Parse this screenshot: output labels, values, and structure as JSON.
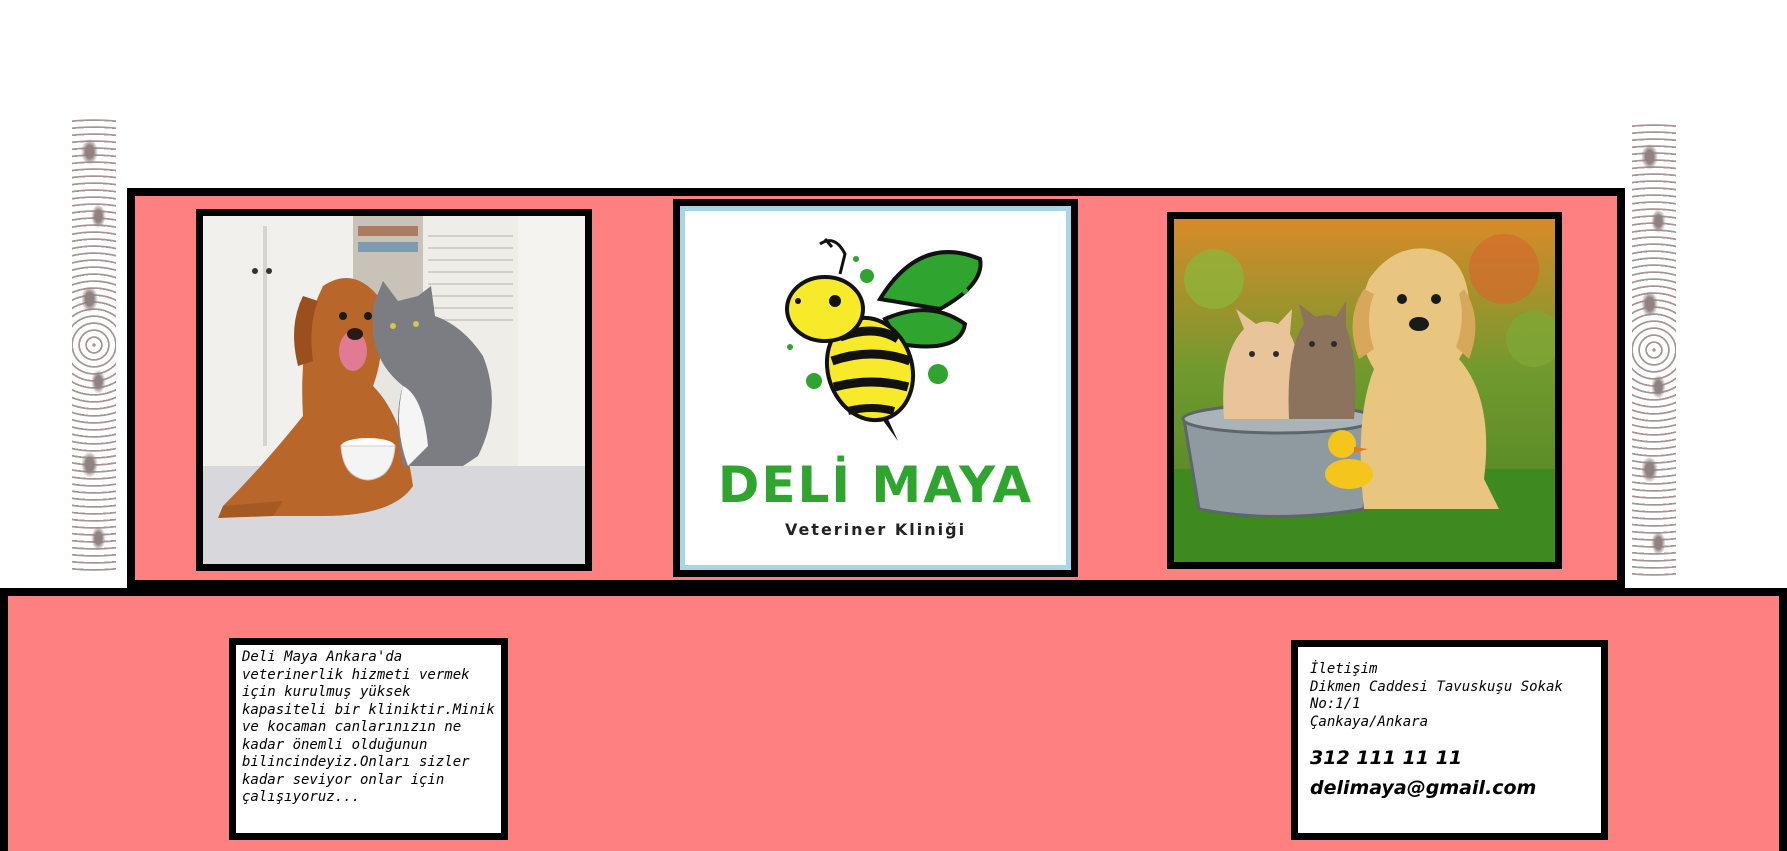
{
  "logo": {
    "title": "DELİ MAYA",
    "subtitle": "Veteriner Kliniği",
    "brand_green": "#2fa52f",
    "bee_yellow": "#f6ea2b"
  },
  "images": {
    "left": "dog-and-cat-photo",
    "right": "puppy-and-kittens-photo"
  },
  "about": {
    "text": "Deli Maya Ankara'da veterinerlik hizmeti vermek için kurulmuş yüksek kapasiteli bir kliniktir.Minik ve kocaman canlarınızın ne kadar önemli olduğunun bilincindeyiz.Onları sizler kadar seviyor onlar için çalışıyoruz..."
  },
  "contact": {
    "heading": "İletişim",
    "address_line1": "Dikmen Caddesi Tavuskuşu Sokak",
    "address_line2": "No:1/1",
    "address_line3": "Çankaya/Ankara",
    "phone": "312 111 11 11",
    "email": "delimaya@gmail.com"
  },
  "colors": {
    "band": "#ff8080",
    "border": "#000000",
    "logo_frame": "#a9d6e5"
  }
}
